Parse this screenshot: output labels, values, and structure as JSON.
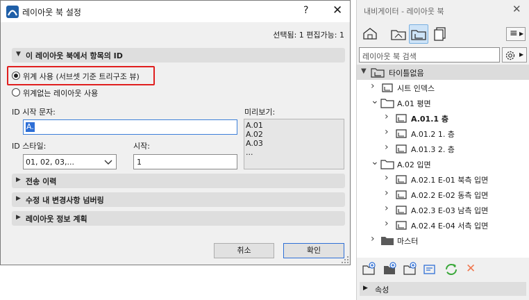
{
  "dialog": {
    "title": "레이아웃 북 설정",
    "help": "?",
    "close": "✕",
    "status": "선택됨: 1 편집가능: 1",
    "id_section": {
      "title": "이 레이아웃 북에서 항목의 ID",
      "option_hierarchy": "위계 사용 (서브셋 기준 트리구조 뷰)",
      "option_no_hierarchy": "위계없는 레이아웃 사용",
      "selected_option": "hierarchy",
      "id_prefix_label": "ID 시작 문자:",
      "id_prefix_value": "A.",
      "preview_label": "미리보기:",
      "preview_lines": [
        "A.01",
        "A.02",
        "A.03",
        "..."
      ],
      "id_style_label": "ID 스타일:",
      "id_style_value": "01, 02, 03,...",
      "start_label": "시작:",
      "start_value": "1"
    },
    "sections": [
      "전송 이력",
      "수정 내 변경사항 넘버링",
      "레이아웃 정보 계획"
    ],
    "cancel_label": "취소",
    "ok_label": "확인"
  },
  "navigator": {
    "title": "내비게이터 - 레이아웃 북",
    "menu_icon": "≡",
    "search_placeholder": "레이아웃 북 검색",
    "tree": {
      "root": "타이틀없음",
      "items": [
        {
          "label": "시트 인덱스",
          "type": "layout",
          "level": 1,
          "arrow": false
        },
        {
          "label": "A.01 평면",
          "type": "folder",
          "level": 1,
          "arrow": true
        },
        {
          "label": "A.01.1 층",
          "type": "layout",
          "level": 2,
          "arrow": false,
          "bold": true
        },
        {
          "label": "A.01.2 1. 층",
          "type": "layout",
          "level": 2,
          "arrow": false
        },
        {
          "label": "A.01.3 2. 층",
          "type": "layout",
          "level": 2,
          "arrow": false
        },
        {
          "label": "A.02 입면",
          "type": "folder",
          "level": 1,
          "arrow": true
        },
        {
          "label": "A.02.1 E-01 북측 입면",
          "type": "layout",
          "level": 2,
          "arrow": false
        },
        {
          "label": "A.02.2 E-02 동측 입면",
          "type": "layout",
          "level": 2,
          "arrow": false
        },
        {
          "label": "A.02.3 E-03 남측 입면",
          "type": "layout",
          "level": 2,
          "arrow": false
        },
        {
          "label": "A.02.4 E-04 서측 입면",
          "type": "layout",
          "level": 2,
          "arrow": false
        },
        {
          "label": "마스터",
          "type": "folder-dark",
          "level": 1,
          "arrow": false
        }
      ]
    },
    "footer_section": "속성",
    "colors": {
      "accent": "#2e6fd6",
      "highlight": "#e01e1e",
      "refresh": "#3aa83a",
      "delete": "#f07850"
    }
  }
}
